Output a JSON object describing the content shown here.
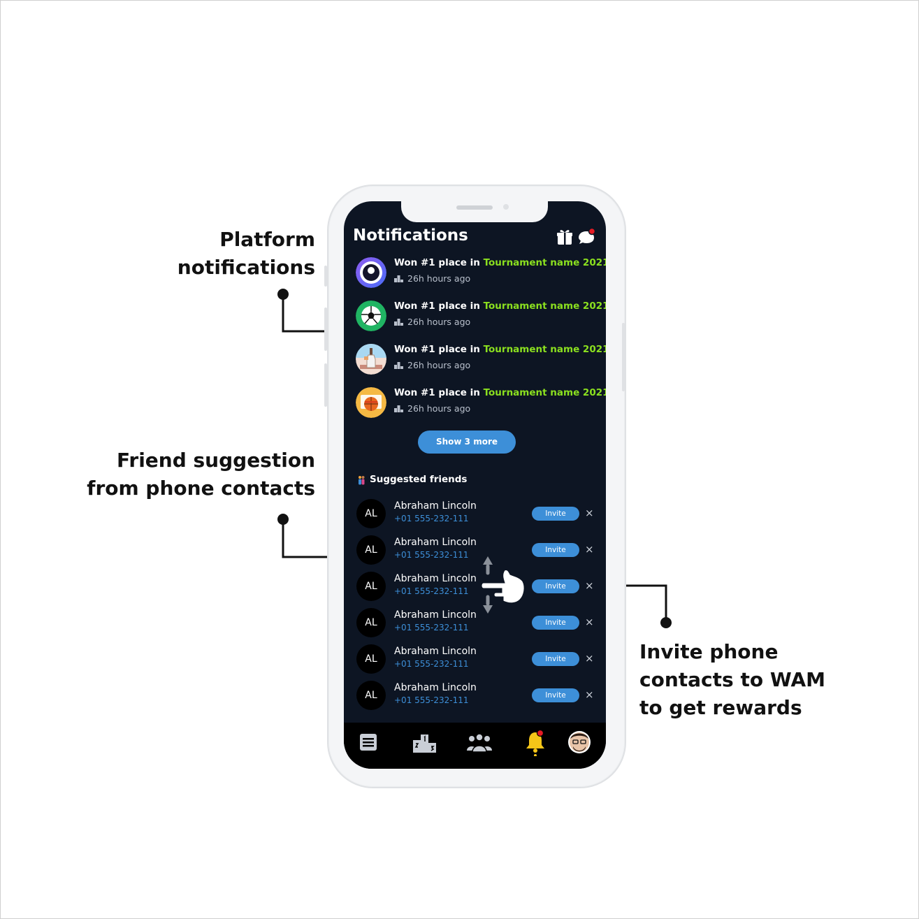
{
  "callouts": {
    "platform": [
      "Platform",
      "notifications"
    ],
    "friend": [
      "Friend suggestion",
      "from phone contacts"
    ],
    "invite": [
      "Invite phone",
      "contacts to WAM",
      "to get rewards"
    ]
  },
  "header": {
    "title": "Notifications"
  },
  "notifications": [
    {
      "prefix": "Won #1 place in ",
      "highlight": "Tournament name 2021",
      "time": "26h hours ago",
      "avatar": "eye-logo"
    },
    {
      "prefix": "Won #1 place in ",
      "highlight": "Tournament name 2021",
      "time": "26h hours ago",
      "avatar": "soccer-ball"
    },
    {
      "prefix": "Won #1 place in ",
      "highlight": "Tournament name 2021",
      "time": "26h hours ago",
      "avatar": "bottle-game"
    },
    {
      "prefix": "Won #1 place in ",
      "highlight": "Tournament name 2021",
      "time": "26h hours ago",
      "avatar": "basketball-hoop"
    }
  ],
  "show_more": "Show 3 more",
  "suggested": {
    "title": "Suggested friends",
    "friends": [
      {
        "initials": "AL",
        "name": "Abraham Lincoln",
        "phone": "+01 555-232-111",
        "invite": "Invite",
        "close": "×"
      },
      {
        "initials": "AL",
        "name": "Abraham Lincoln",
        "phone": "+01 555-232-111",
        "invite": "Invite",
        "close": "×"
      },
      {
        "initials": "AL",
        "name": "Abraham Lincoln",
        "phone": "+01 555-232-111",
        "invite": "Invite",
        "close": "×"
      },
      {
        "initials": "AL",
        "name": "Abraham Lincoln",
        "phone": "+01 555-232-111",
        "invite": "Invite",
        "close": "×"
      },
      {
        "initials": "AL",
        "name": "Abraham Lincoln",
        "phone": "+01 555-232-111",
        "invite": "Invite",
        "close": "×"
      },
      {
        "initials": "AL",
        "name": "Abraham Lincoln",
        "phone": "+01 555-232-111",
        "invite": "Invite",
        "close": "×"
      }
    ]
  },
  "tabbar": [
    "feed-icon",
    "leaderboard-podium-icon",
    "friends-group-icon",
    "notifications-bell-icon",
    "profile-avatar"
  ],
  "colors": {
    "background": "#0d1523",
    "accent": "#3d8fd8",
    "highlight": "#8be01f",
    "bell": "#f5c518",
    "badge": "#e51b24"
  }
}
